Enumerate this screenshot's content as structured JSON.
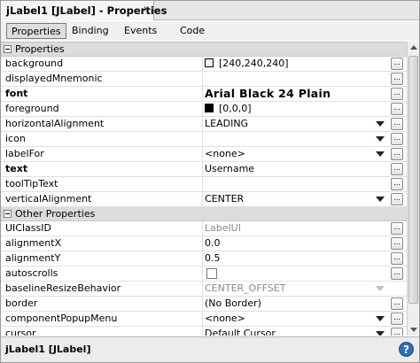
{
  "window": {
    "title": "jLabel1 [JLabel] - Properties",
    "close_glyph": "×"
  },
  "tabs": [
    {
      "label": "Properties",
      "active": true
    },
    {
      "label": "Binding",
      "active": false
    },
    {
      "label": "Events",
      "active": false
    },
    {
      "label": "Code",
      "active": false
    }
  ],
  "categories": {
    "properties": "Properties",
    "other": "Other Properties"
  },
  "properties": [
    {
      "name": "background",
      "value": "[240,240,240]",
      "swatch": "#f0f0f0"
    },
    {
      "name": "displayedMnemonic",
      "value": ""
    },
    {
      "name": "font",
      "value": "Arial Black 24 Plain"
    },
    {
      "name": "foreground",
      "value": "[0,0,0]",
      "swatch": "#000000"
    },
    {
      "name": "horizontalAlignment",
      "value": "LEADING"
    },
    {
      "name": "icon",
      "value": ""
    },
    {
      "name": "labelFor",
      "value": "<none>"
    },
    {
      "name": "text",
      "value": "Username"
    },
    {
      "name": "toolTipText",
      "value": ""
    },
    {
      "name": "verticalAlignment",
      "value": "CENTER"
    }
  ],
  "other_properties": [
    {
      "name": "UIClassID",
      "value": "LabelUI"
    },
    {
      "name": "alignmentX",
      "value": "0.0"
    },
    {
      "name": "alignmentY",
      "value": "0.5"
    },
    {
      "name": "autoscrolls",
      "value": "",
      "checked": false
    },
    {
      "name": "baselineResizeBehavior",
      "value": "CENTER_OFFSET"
    },
    {
      "name": "border",
      "value": "(No Border)"
    },
    {
      "name": "componentPopupMenu",
      "value": "<none>"
    },
    {
      "name": "cursor",
      "value": "Default Cursor"
    }
  ],
  "more_button_label": "...",
  "footer": {
    "text": "jLabel1 [JLabel]",
    "help_glyph": "?"
  },
  "icons": {
    "dropdown": "chevron-down-icon",
    "help": "help-icon",
    "collapse": "collapse-icon"
  }
}
